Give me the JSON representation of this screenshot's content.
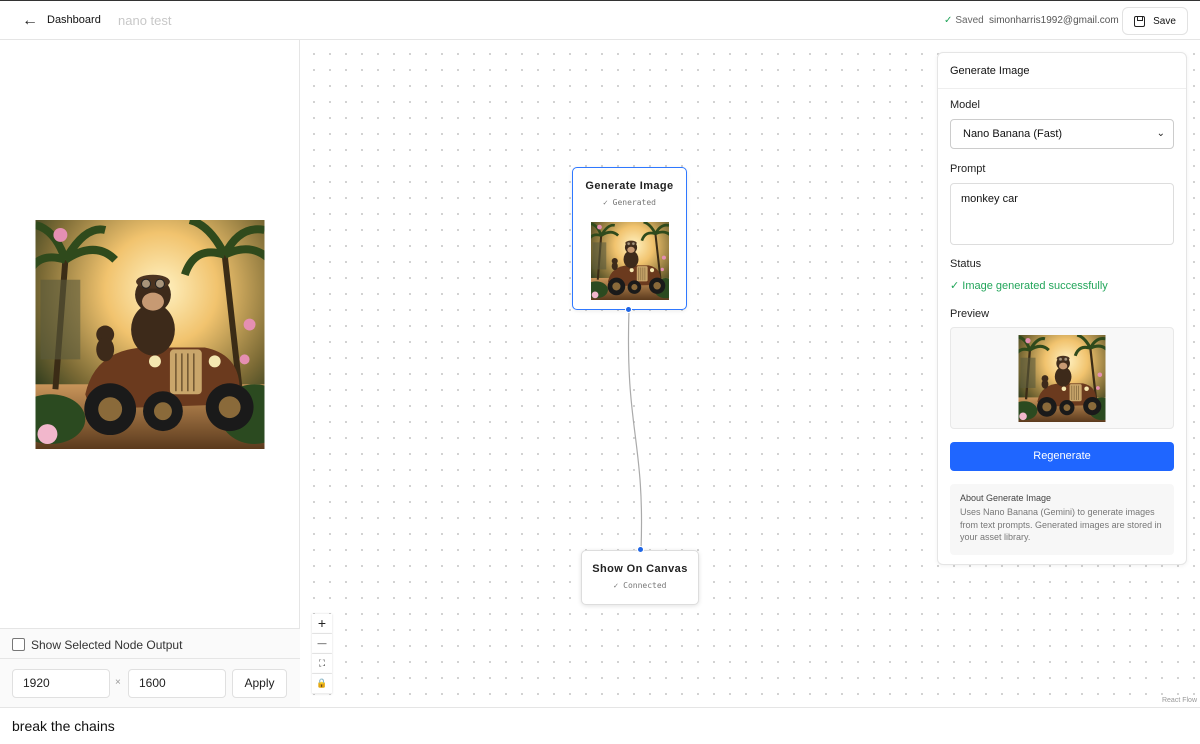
{
  "header": {
    "back_label": "←",
    "dashboard_label": "Dashboard",
    "project_title": "nano test",
    "saved_check": "✓",
    "saved_label": "Saved",
    "email": "simonharris1992@gmail.com",
    "save_label": "Save"
  },
  "left_panel": {
    "show_output_label": "Show Selected Node Output",
    "width_value": "1920",
    "times_symbol": "×",
    "height_value": "1600",
    "apply_label": "Apply"
  },
  "canvas": {
    "nodes": [
      {
        "title": "Generate Image",
        "status": "✓ Generated"
      },
      {
        "title": "Show On Canvas",
        "status": "✓ Connected"
      }
    ],
    "zoom_in": "+",
    "zoom_out": "—",
    "fit": "⛶",
    "lock": "🔒",
    "attribution": "React Flow"
  },
  "properties": {
    "title": "Generate Image",
    "model_label": "Model",
    "model_value": "Nano Banana (Fast)",
    "prompt_label": "Prompt",
    "prompt_value": "monkey car",
    "status_label": "Status",
    "status_value": "✓ Image generated successfully",
    "preview_label": "Preview",
    "regenerate_label": "Regenerate",
    "about_title": "About Generate Image",
    "about_text": "Uses Nano Banana (Gemini) to generate images from text prompts. Generated images are stored in your asset library."
  },
  "chat_input": {
    "value": "break the chains"
  },
  "colors": {
    "accent": "#1f66ff",
    "success": "#22a55a",
    "node_border": "#2f78ff"
  }
}
